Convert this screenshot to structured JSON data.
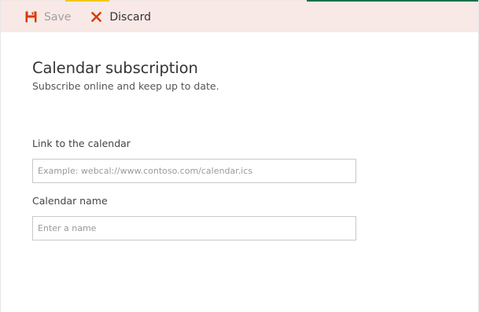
{
  "toolbar": {
    "save_label": "Save",
    "save_icon": "floppy-disk-icon",
    "discard_label": "Discard",
    "discard_icon": "close-x-icon",
    "accent_color": "#d83b01",
    "background_color": "#f8e9e6"
  },
  "header": {
    "title": "Calendar subscription",
    "subtitle": "Subscribe online and keep up to date."
  },
  "fields": {
    "link": {
      "label": "Link to the calendar",
      "value": "",
      "placeholder": "Example: webcal://www.contoso.com/calendar.ics"
    },
    "name": {
      "label": "Calendar name",
      "value": "",
      "placeholder": "Enter a name"
    }
  }
}
